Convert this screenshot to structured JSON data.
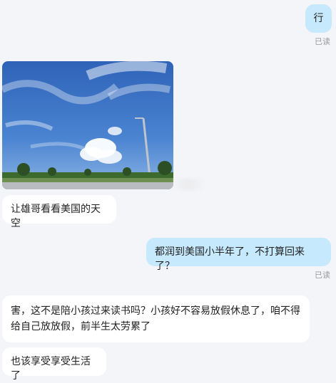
{
  "messages": [
    {
      "text": "行",
      "read": "已读"
    },
    {
      "text": "让雄哥看看美国的天空"
    },
    {
      "text": "都润到美国小半年了，不打算回来了？",
      "read": "已读"
    },
    {
      "text": "害，这不是陪小孩过来读书吗？小孩好不容易放假休息了，咱不得给自己放放假，前半生太劳累了"
    },
    {
      "text": "也该享受享受生活了"
    }
  ]
}
